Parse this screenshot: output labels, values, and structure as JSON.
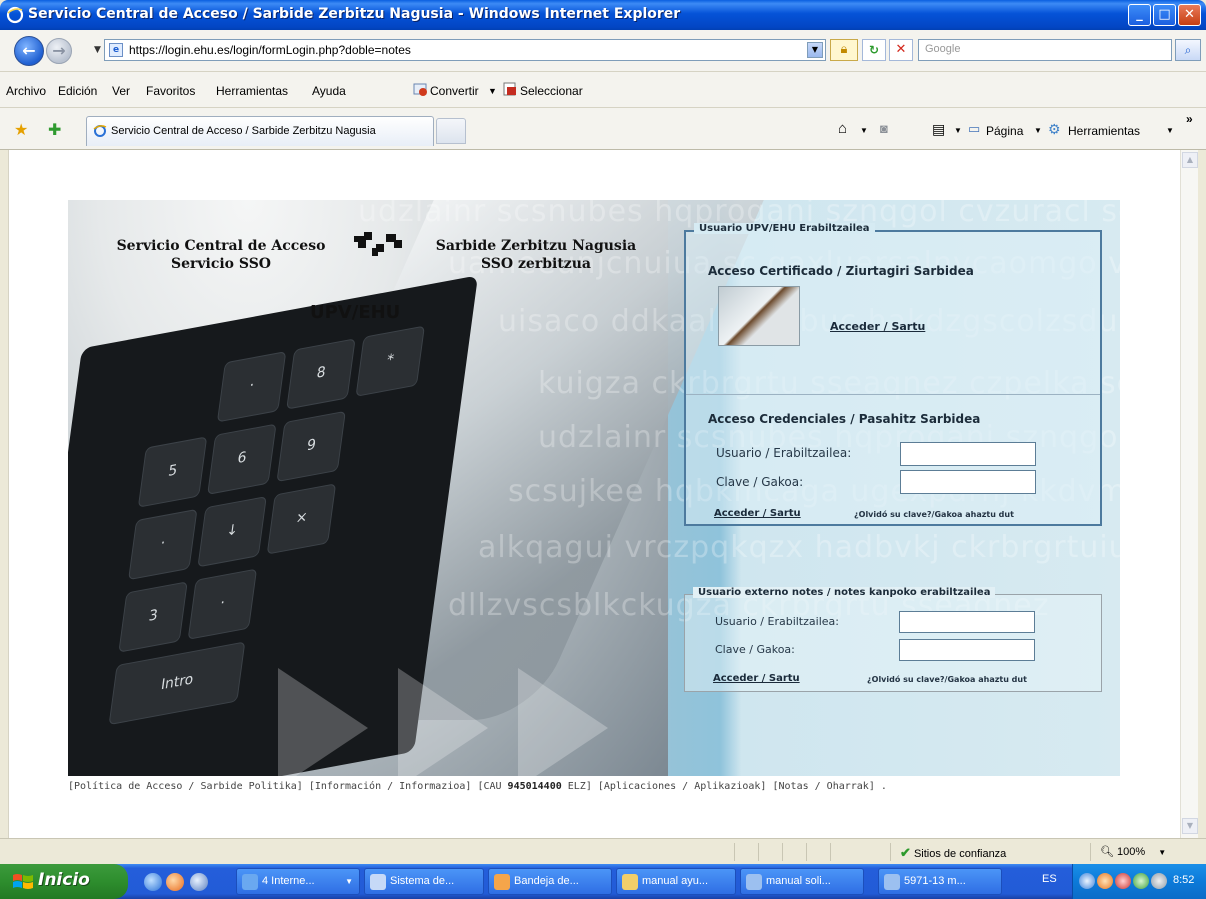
{
  "window": {
    "title": "Servicio Central de Acceso / Sarbide Zerbitzu Nagusia - Windows Internet Explorer",
    "minimize": "_",
    "maximize": "□",
    "close": "✕"
  },
  "address": {
    "url": "https://login.ehu.es/login/formLogin.php?doble=notes",
    "search_placeholder": "Google"
  },
  "menu": {
    "items": [
      "Archivo",
      "Edición",
      "Ver",
      "Favoritos",
      "Herramientas",
      "Ayuda"
    ],
    "convertir": "Convertir",
    "seleccionar": "Seleccionar"
  },
  "tabs": {
    "active_label": "Servicio Central de Acceso / Sarbide Zerbitzu Nagusia",
    "pagina": "Página",
    "herramientas": "Herramientas",
    "overflow": "»"
  },
  "page": {
    "brand_left_line1": "Servicio Central de Acceso",
    "brand_left_line2": "Servicio SSO",
    "brand_right_line1": "Sarbide Zerbitzu Nagusia",
    "brand_right_line2": "SSO zerbitzua",
    "university": "UPV/EHU",
    "upv_panel": {
      "legend": "Usuario UPV/EHU Erabiltzailea",
      "cert_title": "Acceso Certificado / Ziurtagiri Sarbidea",
      "cert_link": "Acceder / Sartu",
      "cred_title": "Acceso Credenciales / Pasahitz Sarbidea",
      "user_label": "Usuario / Erabiltzailea:",
      "pass_label": "Clave / Gakoa:",
      "submit_link": "Acceder / Sartu",
      "forgot": "¿Olvidó su clave?/Gakoa ahaztu dut"
    },
    "notes_panel": {
      "legend": "Usuario externo notes / notes kanpoko erabiltzailea",
      "user_label": "Usuario / Erabiltzailea:",
      "pass_label": "Clave / Gakoa:",
      "submit_link": "Acceder / Sartu",
      "forgot": "¿Olvidó su clave?/Gakoa ahaztu dut"
    },
    "footer": {
      "policy": "[Política de Acceso / Sarbide Politika]",
      "info": "[Información / Informazioa]",
      "cau_prefix": "[CAU ",
      "cau_number": "945014400",
      "cau_suffix": " ELZ]",
      "apps": "[Aplicaciones / Aplikazioak]",
      "notes": "[Notas / Oharrak]",
      "dot": "."
    }
  },
  "status": {
    "zone": "Sitios de confianza",
    "zoom": "100%"
  },
  "taskbar": {
    "start": "Inicio",
    "tasks": [
      "4 Interne...",
      "Sistema de...",
      "Bandeja de...",
      "manual ayu...",
      "manual soli...",
      "5971-13 m..."
    ],
    "lang": "ES",
    "clock": "8:52"
  },
  "colors": {
    "xp_blue": "#0553d8",
    "panel_border": "#4d7a9e",
    "start_green": "#2f8f2f"
  }
}
